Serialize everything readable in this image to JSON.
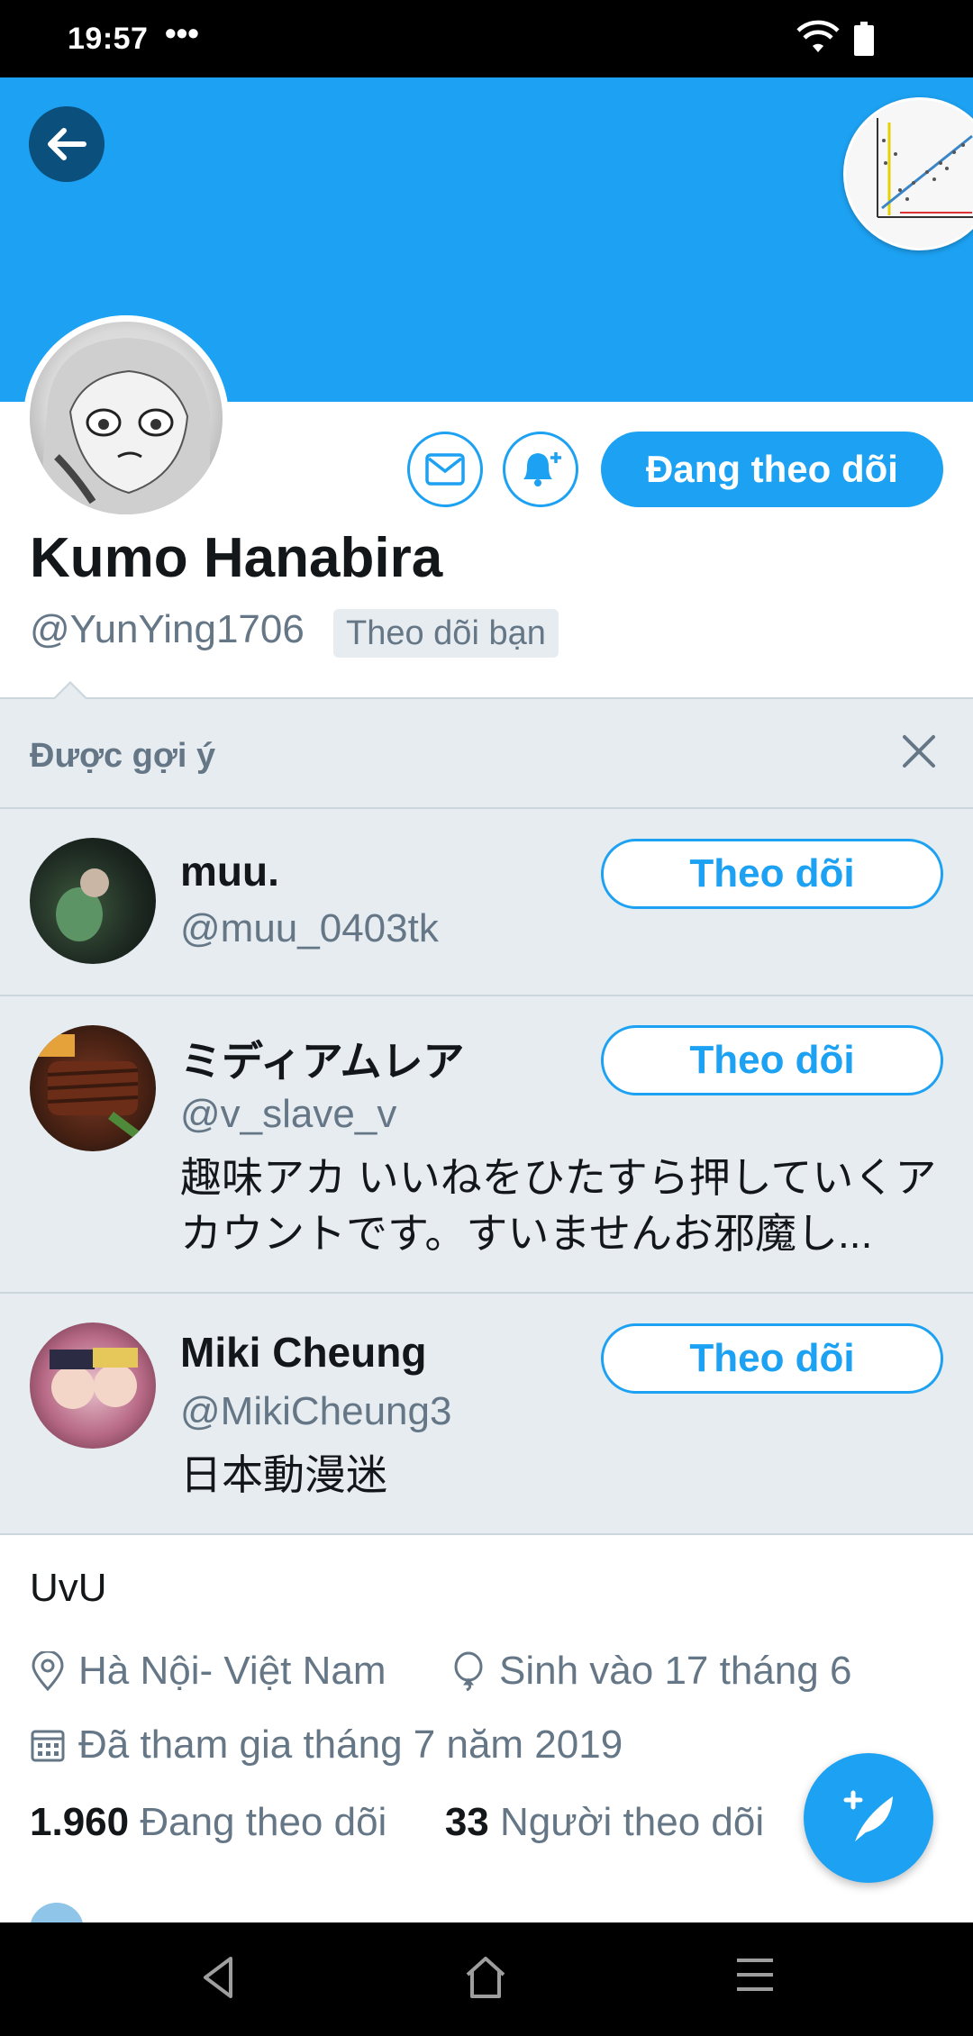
{
  "status_bar": {
    "time": "19:57",
    "more": "•••"
  },
  "profile": {
    "display_name": "Kumo Hanabira",
    "handle": "@YunYing1706",
    "follows_you": "Theo dõi bạn",
    "following_label": "Đang theo dõi",
    "bio": "UvU",
    "location": "Hà Nội- Việt Nam",
    "birthday": "Sinh vào 17 tháng 6",
    "joined": "Đã tham gia tháng 7 năm 2019",
    "following_count": "1.960",
    "following_label_text": "Đang theo dõi",
    "followers_count": "33",
    "followers_label_text": "Người theo dõi"
  },
  "suggested": {
    "title": "Được gợi ý",
    "follow_label": "Theo dõi",
    "users": [
      {
        "name": "muu.",
        "handle": "@muu_0403tk",
        "bio": ""
      },
      {
        "name": "ミディアムレア",
        "handle": "@v_slave_v",
        "bio": "趣味アカ いいねをひたすら押していくアカウントです。すいませんお邪魔し..."
      },
      {
        "name": "Miki Cheung",
        "handle": "@MikiCheung3",
        "bio": "日本動漫迷"
      }
    ]
  },
  "icons": {
    "back": "back-arrow-icon",
    "message": "mail-icon",
    "notify": "bell-plus-icon",
    "close": "close-icon",
    "location": "location-pin-icon",
    "birthday": "balloon-icon",
    "calendar": "calendar-icon",
    "compose": "compose-tweet-icon"
  },
  "colors": {
    "accent": "#1da1f2",
    "muted": "#657786",
    "suggest_bg": "#e6ecf0"
  }
}
